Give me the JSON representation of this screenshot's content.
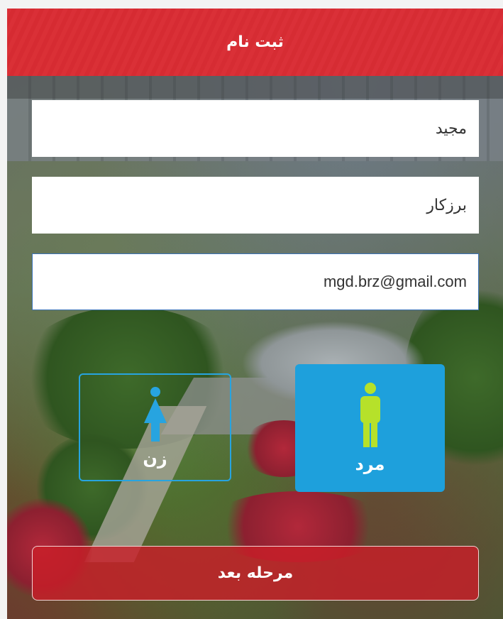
{
  "header": {
    "title": "ثبت نام"
  },
  "form": {
    "first_name": {
      "value": "مجید"
    },
    "last_name": {
      "value": "برزکار"
    },
    "email": {
      "value": "mgd.brz@gmail.com"
    }
  },
  "gender": {
    "female_label": "زن",
    "male_label": "مرد",
    "selected": "male"
  },
  "actions": {
    "next_label": "مرحله بعد"
  },
  "colors": {
    "header_overlay": "#e61e28",
    "selected_tile": "#1ea0dc",
    "tile_border": "#27a4e0",
    "male_icon": "#b6e12a",
    "female_icon": "#27a4e0",
    "next_button": "#c81e28",
    "active_field_border": "#3b73b9"
  },
  "icons": {
    "female": "female-icon",
    "male": "male-icon"
  }
}
